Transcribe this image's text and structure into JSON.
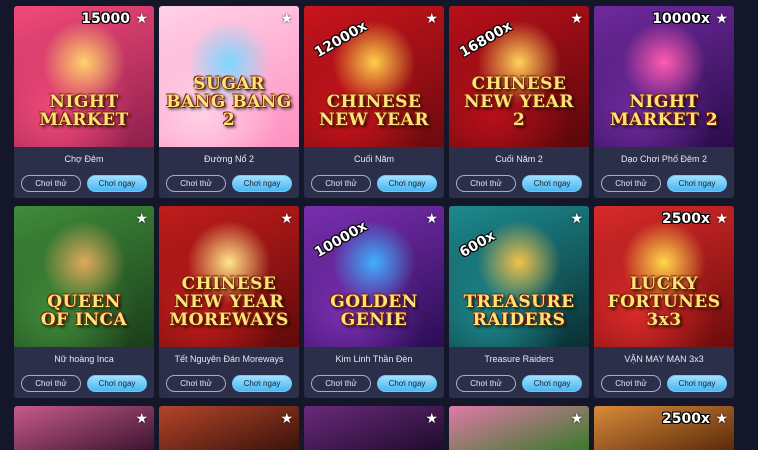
{
  "games": [
    {
      "name": "Chợ Đêm",
      "art_title": [
        "NIGHT",
        "MARKET"
      ],
      "badge": "FC",
      "multiplier": "15000",
      "bg1": "#f24a7a",
      "bg2": "#8e1f4c",
      "bg3": "#ffd36b"
    },
    {
      "name": "Đường Nổ 2",
      "art_title": [
        "SUGAR",
        "BANG BANG 2"
      ],
      "multiplier": "",
      "bg1": "#ffd1e6",
      "bg2": "#ff8fc0",
      "bg3": "#7ad7ff"
    },
    {
      "name": "Cuối Năm",
      "art_title": [
        "CHINESE",
        "NEW YEAR"
      ],
      "multiplier": "12000x",
      "bg1": "#c9141c",
      "bg2": "#6b0a0e",
      "bg3": "#ffce4a"
    },
    {
      "name": "Cuối Năm 2",
      "art_title": [
        "CHINESE",
        "NEW YEAR 2"
      ],
      "multiplier": "16800x",
      "bg1": "#b8101a",
      "bg2": "#5a070b",
      "bg3": "#ffd35a"
    },
    {
      "name": "Dạo Chơi Phố Đêm 2",
      "art_title": [
        "NIGHT",
        "MARKET 2"
      ],
      "multiplier": "10000x",
      "bg1": "#6f2a9e",
      "bg2": "#2a0c4a",
      "bg3": "#ff5bb0"
    },
    {
      "name": "Nữ hoàng Inca",
      "art_title": [
        "QUEEN",
        "OF INCA"
      ],
      "multiplier": "",
      "bg1": "#3f8c3a",
      "bg2": "#1b3d1a",
      "bg3": "#e0a95a"
    },
    {
      "name": "Tết Nguyên Đán Moreways",
      "art_title": [
        "CHINESE NEW YEAR",
        "MOREWAYS"
      ],
      "multiplier": "",
      "bg1": "#c21c1c",
      "bg2": "#5f0a0a",
      "bg3": "#ffe58a"
    },
    {
      "name": "Kim Linh Thần Đèn",
      "art_title": [
        "GOLDEN",
        "GENIE"
      ],
      "multiplier": "10000x",
      "bg1": "#7a2fb0",
      "bg2": "#2b0d55",
      "bg3": "#3fb0ff"
    },
    {
      "name": "Treasure Raiders",
      "art_title": [
        "TREASURE",
        "RAIDERS"
      ],
      "multiplier": "600x",
      "bg1": "#1d8a8e",
      "bg2": "#0a2f33",
      "bg3": "#f2c14a"
    },
    {
      "name": "VẬN MAY MẠN 3x3",
      "art_title": [
        "LUCKY",
        "FORTUNES 3x3"
      ],
      "multiplier": "2500x",
      "bg1": "#d92a2a",
      "bg2": "#6d0c0c",
      "bg3": "#ffd84a"
    }
  ],
  "partial_row": [
    {
      "bg1": "#c75b8a",
      "bg2": "#3b1430",
      "multiplier": ""
    },
    {
      "bg1": "#b4452a",
      "bg2": "#3a120a",
      "multiplier": ""
    },
    {
      "bg1": "#6a2a7a",
      "bg2": "#1f0b2e",
      "multiplier": ""
    },
    {
      "bg1": "#e07aa8",
      "bg2": "#3a7a2a",
      "multiplier": ""
    },
    {
      "bg1": "#d98a3a",
      "bg2": "#5a2a0a",
      "multiplier": "2500x"
    }
  ],
  "buttons": {
    "try_label": "Chơi thử",
    "play_label": "Chơi ngay"
  },
  "colors": {
    "background": "#14172a",
    "card": "#2b2f4a",
    "play_button": "#4ab7f2"
  }
}
